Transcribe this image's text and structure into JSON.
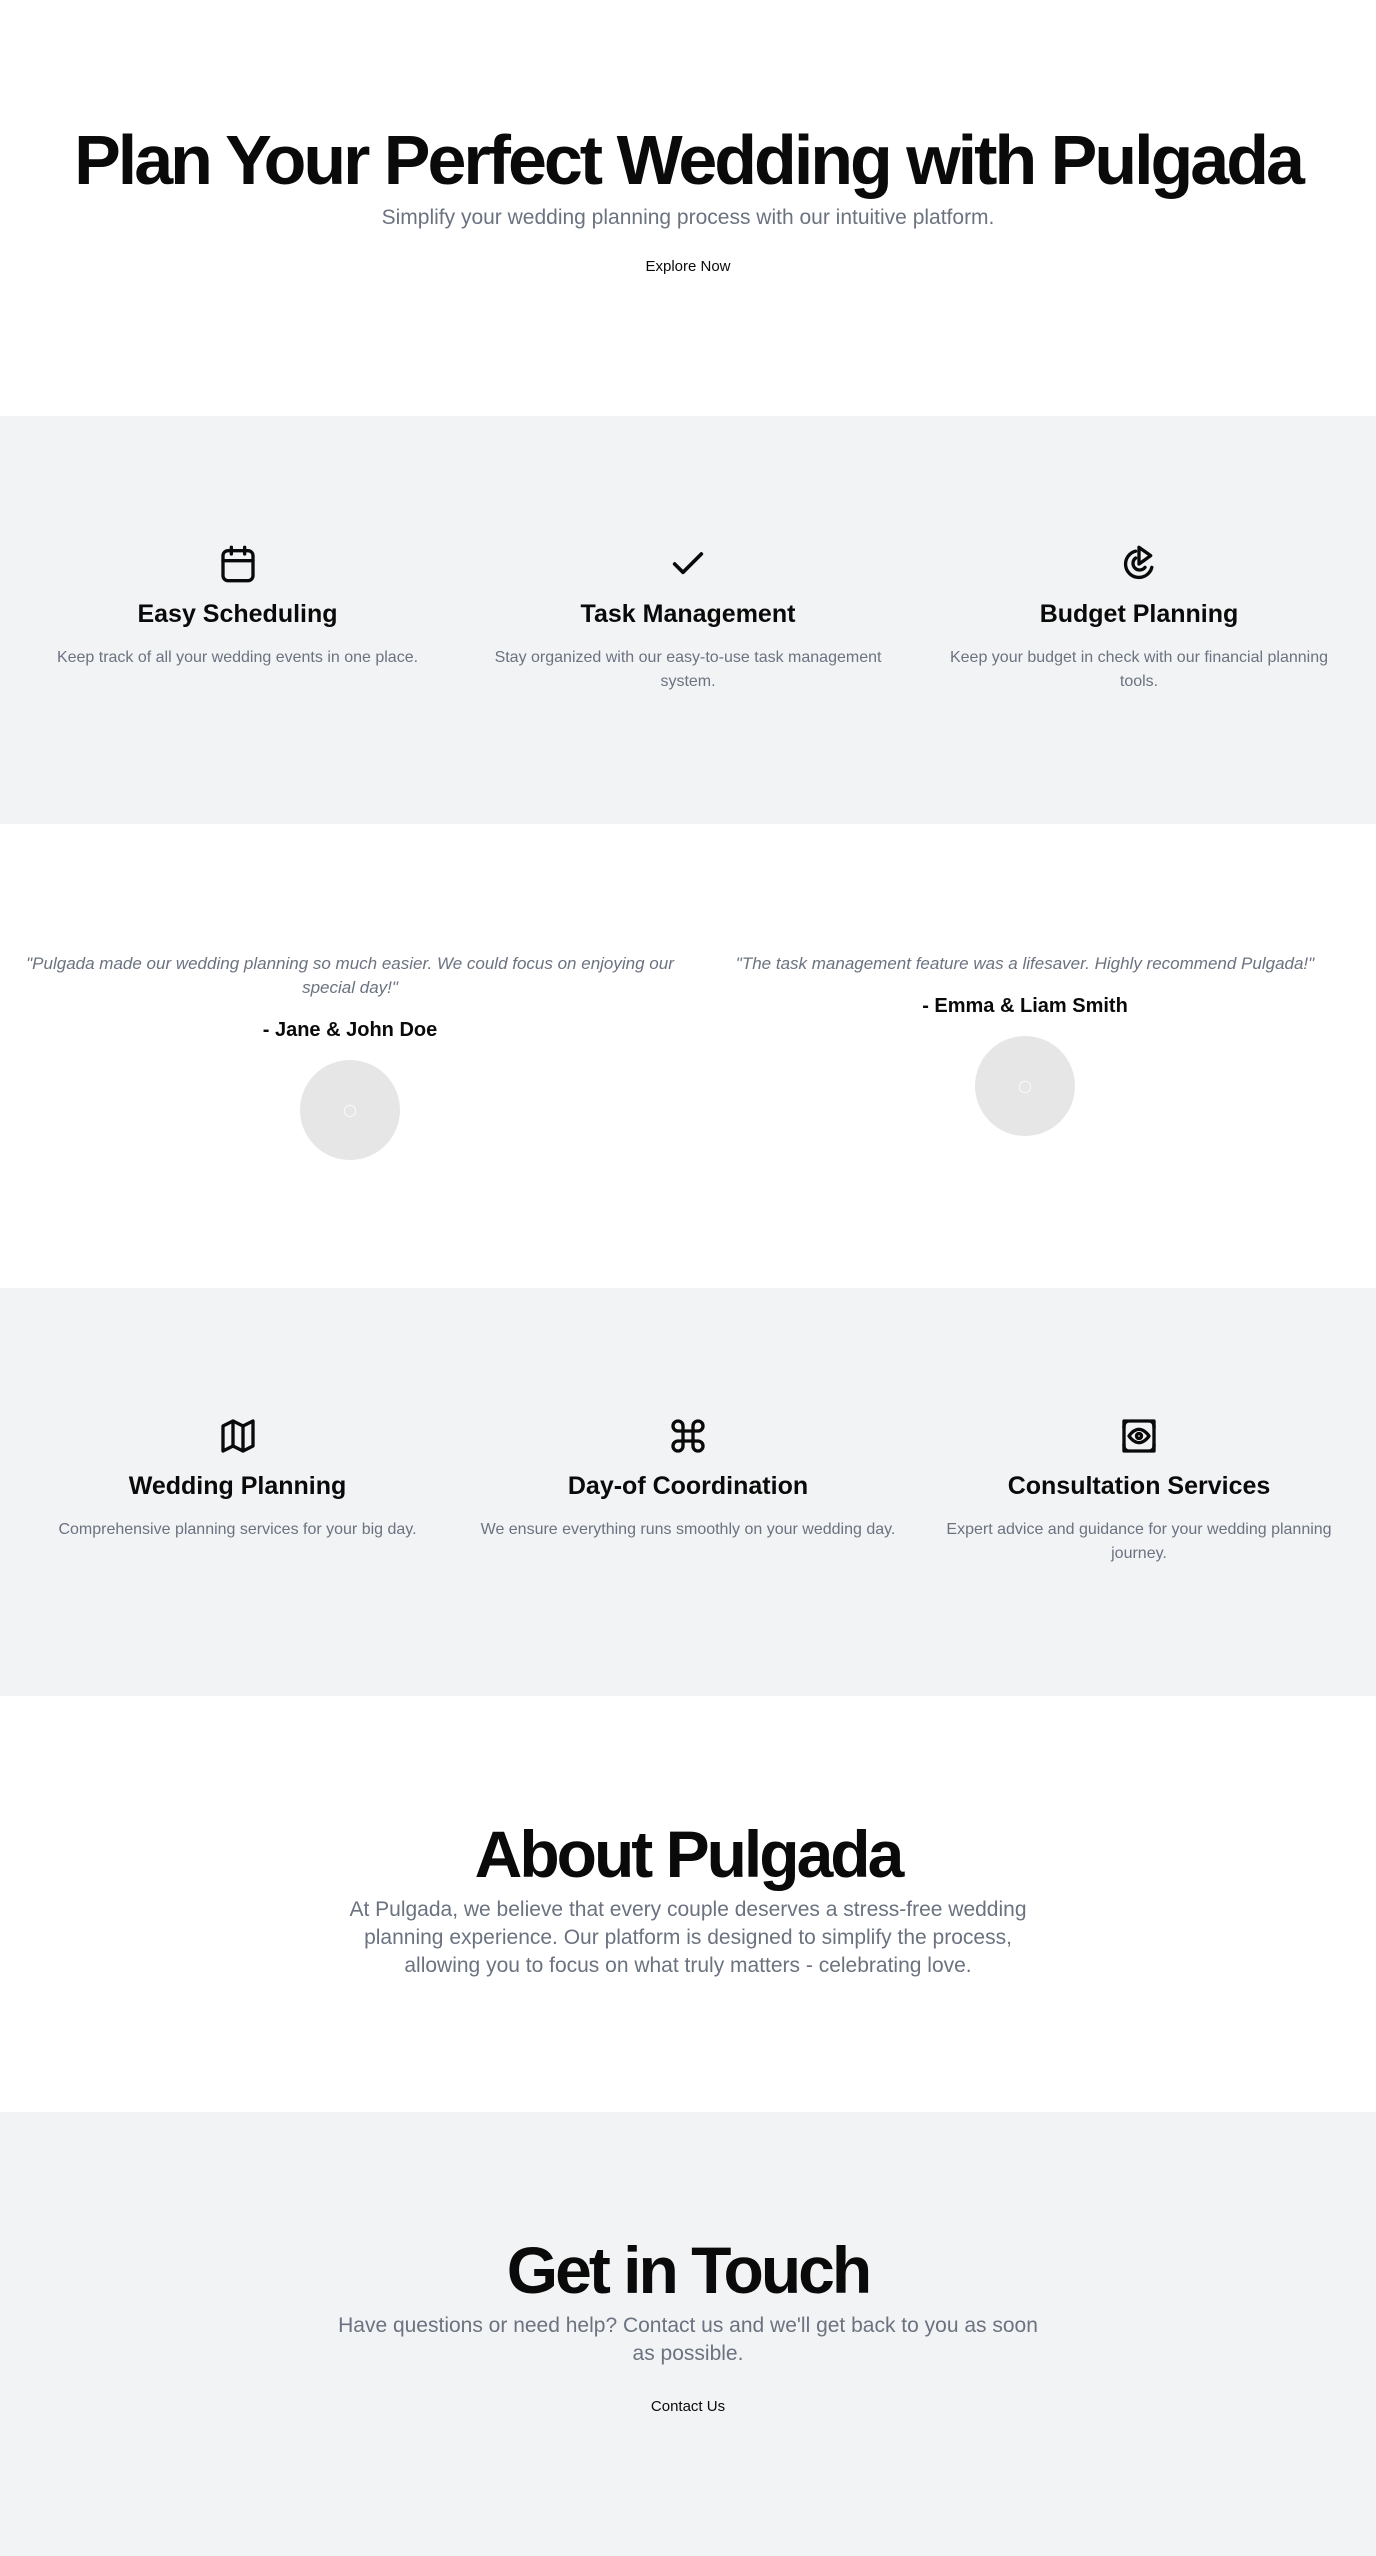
{
  "hero": {
    "title": "Plan Your Perfect Wedding with Pulgada",
    "subtitle": "Simplify your wedding planning process with our intuitive platform.",
    "cta_label": "Explore Now"
  },
  "features": {
    "items": [
      {
        "icon": "calendar-icon",
        "title": "Easy Scheduling",
        "text": "Keep track of all your wedding events in one place."
      },
      {
        "icon": "check-icon",
        "title": "Task Management",
        "text": "Stay organized with our easy-to-use task management system."
      },
      {
        "icon": "budget-chart-icon",
        "title": "Budget Planning",
        "text": "Keep your budget in check with our financial planning tools."
      }
    ]
  },
  "testimonials": {
    "items": [
      {
        "quote": "\"Pulgada made our wedding planning so much easier. We could focus on enjoying our special day!\"",
        "author": "- Jane & John Doe"
      },
      {
        "quote": "\"The task management feature was a lifesaver. Highly recommend Pulgada!\"",
        "author": "- Emma & Liam Smith"
      }
    ]
  },
  "services": {
    "items": [
      {
        "icon": "map-icon",
        "title": "Wedding Planning",
        "text": "Comprehensive planning services for your big day."
      },
      {
        "icon": "command-icon",
        "title": "Day-of Coordination",
        "text": "We ensure everything runs smoothly on your wedding day."
      },
      {
        "icon": "view-eye-icon",
        "title": "Consultation Services",
        "text": "Expert advice and guidance for your wedding planning journey."
      }
    ]
  },
  "about": {
    "title": "About Pulgada",
    "body": "At Pulgada, we believe that every couple deserves a stress-free wedding planning experience. Our platform is designed to simplify the process, allowing you to focus on what truly matters - celebrating love."
  },
  "contact": {
    "title": "Get in Touch",
    "body": "Have questions or need help? Contact us and we'll get back to you as soon as possible.",
    "cta_label": "Contact Us"
  }
}
